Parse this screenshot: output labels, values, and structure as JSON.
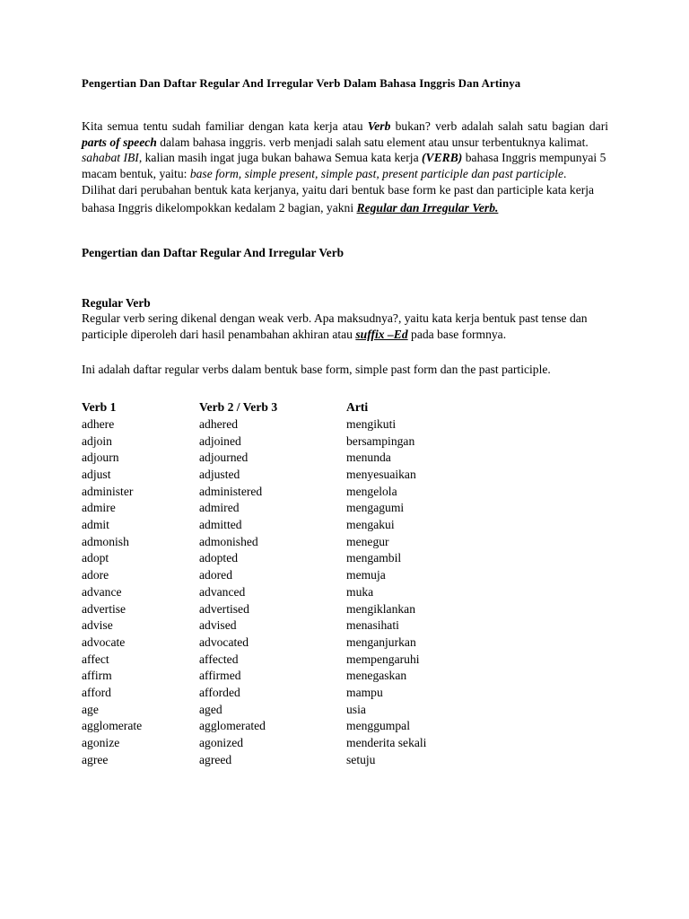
{
  "document": {
    "title": "Pengertian Dan Daftar Regular And Irregular Verb Dalam Bahasa Inggris  Dan Artinya",
    "paragraph_1": {
      "run_1": "Kita semua tentu sudah familiar dengan kata kerja atau ",
      "run_2_bold_italic": "Verb",
      "run_3": " bukan? verb adalah salah satu bagian dari ",
      "run_4_bold_italic": "parts of speech",
      "run_5": " dalam bahasa inggris. verb menjadi salah satu element atau unsur terbentuknya kalimat."
    },
    "paragraph_2": {
      "run_1_italic": "sahabat IBI",
      "run_2": ", kalian masih ingat juga bukan bahawa Semua kata kerja ",
      "run_3_bold_italic": "(VERB)",
      "run_4": " bahasa Inggris mempunyai 5 macam bentuk, yaitu: ",
      "run_5_italic": "base form, simple present, simple past, present participle dan past participle",
      "run_6": "."
    },
    "paragraph_3": {
      "run_1": "Dilihat dari perubahan bentuk kata kerjanya, yaitu dari bentuk base form ke past dan participle kata kerja bahasa Inggris dikelompokkan kedalam 2 bagian, yakni ",
      "run_2_bold_italic_underline": "Regular dan Irregular Verb."
    },
    "heading_section": "Pengertian dan Daftar Regular And Irregular Verb",
    "heading_regular_verb": "Regular Verb",
    "paragraph_4": {
      "run_1": "Regular verb sering dikenal dengan weak verb. Apa maksudnya?, yaitu kata kerja bentuk past tense dan participle diperoleh dari hasil penambahan akhiran atau ",
      "run_2_bold_italic_underline": "suffix –Ed",
      "run_3": " pada base formnya."
    },
    "paragraph_5": "Ini adalah daftar regular verbs dalam bentuk  base form, simple past form dan the past participle."
  },
  "verb_table": {
    "headers": [
      "Verb 1",
      "Verb 2 / Verb 3",
      "Arti"
    ],
    "rows": [
      [
        "adhere",
        "adhered",
        "mengikuti"
      ],
      [
        "adjoin",
        "adjoined",
        "bersampingan"
      ],
      [
        "adjourn",
        "adjourned",
        "menunda"
      ],
      [
        "adjust",
        "adjusted",
        "menyesuaikan"
      ],
      [
        "administer",
        "administered",
        "mengelola"
      ],
      [
        "admire",
        "admired",
        "mengagumi"
      ],
      [
        "admit",
        "admitted",
        "mengakui"
      ],
      [
        "admonish",
        "admonished",
        "menegur"
      ],
      [
        "adopt",
        "adopted",
        "mengambil"
      ],
      [
        "adore",
        "adored",
        "memuja"
      ],
      [
        "advance",
        "advanced",
        "muka"
      ],
      [
        "advertise",
        "advertised",
        "mengiklankan"
      ],
      [
        "advise",
        "advised",
        "menasihati"
      ],
      [
        "advocate",
        "advocated",
        "menganjurkan"
      ],
      [
        "affect",
        "affected",
        "mempengaruhi"
      ],
      [
        "affirm",
        "affirmed",
        "menegaskan"
      ],
      [
        "afford",
        "afforded",
        "mampu"
      ],
      [
        "age",
        "aged",
        "usia"
      ],
      [
        "agglomerate",
        "agglomerated",
        "menggumpal"
      ],
      [
        "agonize",
        "agonized",
        "menderita sekali"
      ],
      [
        "agree",
        "agreed",
        "setuju"
      ]
    ]
  },
  "colors": {
    "page_background": "#ffffff",
    "text": "#000000"
  }
}
